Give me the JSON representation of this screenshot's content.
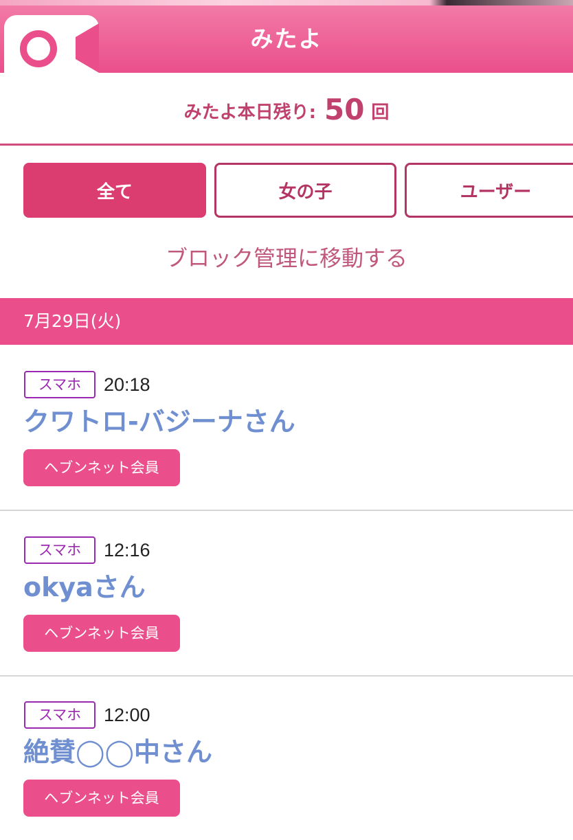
{
  "header": {
    "title": "みたよ"
  },
  "remaining": {
    "label": "みたよ本日残り:",
    "count": "50",
    "unit": "回"
  },
  "filters": [
    {
      "label": "全て",
      "selected": true
    },
    {
      "label": "女の子",
      "selected": false
    },
    {
      "label": "ユーザー",
      "selected": false
    }
  ],
  "block_link": "ブロック管理に移動する",
  "date": "7月29日(火)",
  "entries": [
    {
      "device": "スマホ",
      "time": "20:18",
      "name": "クワトロ-バジーナさん",
      "member": "ヘブンネット会員"
    },
    {
      "device": "スマホ",
      "time": "12:16",
      "name": "okyaさん",
      "member": "ヘブンネット会員"
    },
    {
      "device": "スマホ",
      "time": "12:00",
      "name": "絶賛◯◯中さん",
      "member": "ヘブンネット会員"
    }
  ],
  "colors": {
    "header": "#ea4f8b",
    "accent": "#db3d70",
    "link": "#6f8fd0",
    "device_tag": "#9b28b0"
  },
  "icons": {
    "logo": "video-camera-icon"
  }
}
